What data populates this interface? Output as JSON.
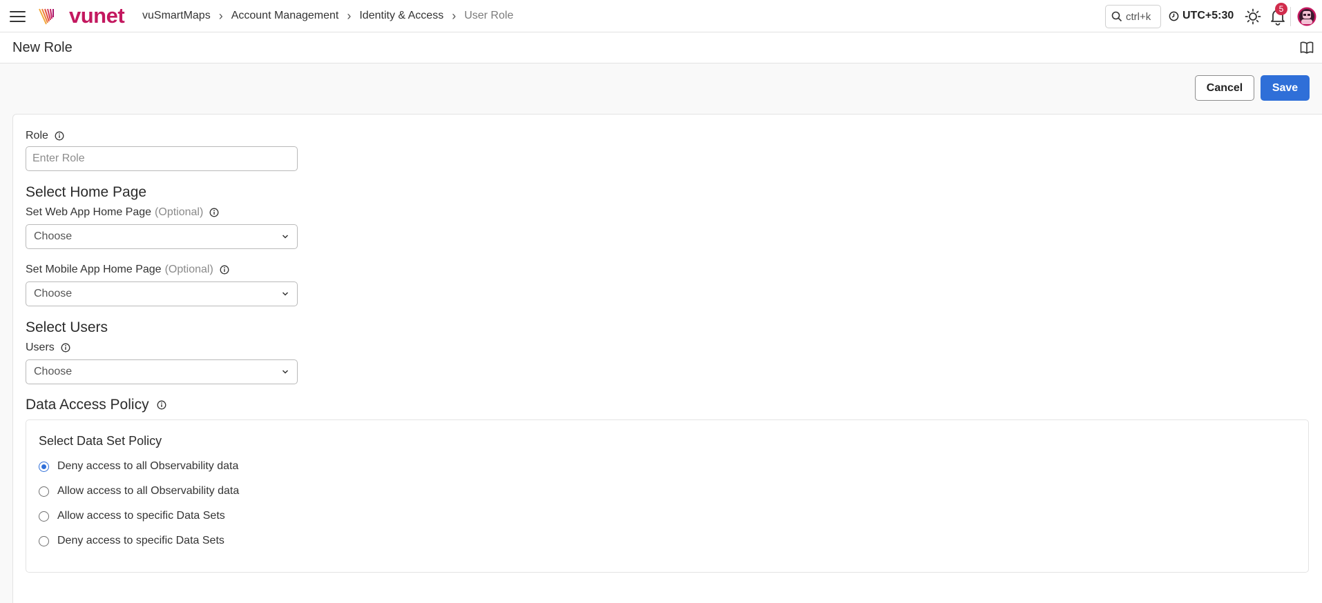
{
  "app": {
    "brand": "vunet",
    "accent_color": "#c3185f",
    "primary_color": "#2f6fd8"
  },
  "topbar": {
    "breadcrumb": [
      "vuSmartMaps",
      "Account Management",
      "Identity & Access"
    ],
    "breadcrumb_current": "User Role",
    "search_shortcut": "ctrl+k",
    "timezone": "UTC+5:30",
    "notification_count": "5"
  },
  "page": {
    "title": "New Role"
  },
  "actions": {
    "cancel_label": "Cancel",
    "save_label": "Save"
  },
  "form": {
    "role_label": "Role",
    "role_placeholder": "Enter Role",
    "home_section_title": "Select Home Page",
    "web_home_label": "Set Web App Home Page",
    "web_home_optional": "(Optional)",
    "web_home_value": "Choose",
    "mobile_home_label": "Set Mobile App Home Page",
    "mobile_home_optional": "(Optional)",
    "mobile_home_value": "Choose",
    "users_section_title": "Select Users",
    "users_label": "Users",
    "users_value": "Choose",
    "policy_section_title": "Data Access Policy",
    "dataset_policy_title": "Select Data Set Policy",
    "policy_options": [
      {
        "label": "Deny access to all Observability data",
        "selected": true
      },
      {
        "label": "Allow access to all Observability data",
        "selected": false
      },
      {
        "label": "Allow access to specific Data Sets",
        "selected": false
      },
      {
        "label": "Deny access to specific Data Sets",
        "selected": false
      }
    ]
  }
}
